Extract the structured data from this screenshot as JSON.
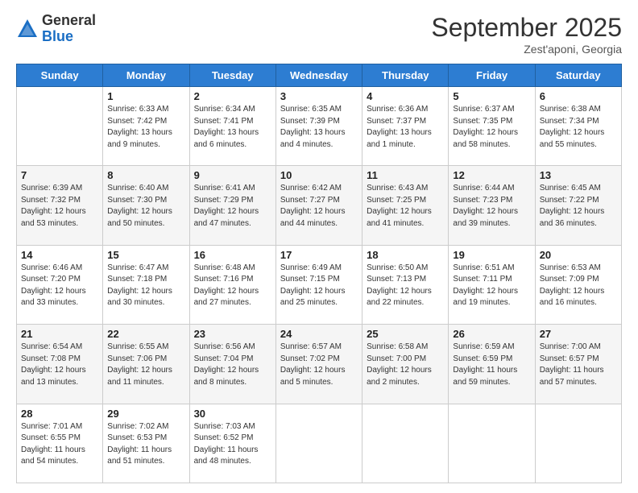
{
  "logo": {
    "general": "General",
    "blue": "Blue"
  },
  "header": {
    "month": "September 2025",
    "location": "Zest'aponi, Georgia"
  },
  "weekdays": [
    "Sunday",
    "Monday",
    "Tuesday",
    "Wednesday",
    "Thursday",
    "Friday",
    "Saturday"
  ],
  "weeks": [
    [
      {
        "day": "",
        "content": ""
      },
      {
        "day": "1",
        "content": "Sunrise: 6:33 AM\nSunset: 7:42 PM\nDaylight: 13 hours\nand 9 minutes."
      },
      {
        "day": "2",
        "content": "Sunrise: 6:34 AM\nSunset: 7:41 PM\nDaylight: 13 hours\nand 6 minutes."
      },
      {
        "day": "3",
        "content": "Sunrise: 6:35 AM\nSunset: 7:39 PM\nDaylight: 13 hours\nand 4 minutes."
      },
      {
        "day": "4",
        "content": "Sunrise: 6:36 AM\nSunset: 7:37 PM\nDaylight: 13 hours\nand 1 minute."
      },
      {
        "day": "5",
        "content": "Sunrise: 6:37 AM\nSunset: 7:35 PM\nDaylight: 12 hours\nand 58 minutes."
      },
      {
        "day": "6",
        "content": "Sunrise: 6:38 AM\nSunset: 7:34 PM\nDaylight: 12 hours\nand 55 minutes."
      }
    ],
    [
      {
        "day": "7",
        "content": "Sunrise: 6:39 AM\nSunset: 7:32 PM\nDaylight: 12 hours\nand 53 minutes."
      },
      {
        "day": "8",
        "content": "Sunrise: 6:40 AM\nSunset: 7:30 PM\nDaylight: 12 hours\nand 50 minutes."
      },
      {
        "day": "9",
        "content": "Sunrise: 6:41 AM\nSunset: 7:29 PM\nDaylight: 12 hours\nand 47 minutes."
      },
      {
        "day": "10",
        "content": "Sunrise: 6:42 AM\nSunset: 7:27 PM\nDaylight: 12 hours\nand 44 minutes."
      },
      {
        "day": "11",
        "content": "Sunrise: 6:43 AM\nSunset: 7:25 PM\nDaylight: 12 hours\nand 41 minutes."
      },
      {
        "day": "12",
        "content": "Sunrise: 6:44 AM\nSunset: 7:23 PM\nDaylight: 12 hours\nand 39 minutes."
      },
      {
        "day": "13",
        "content": "Sunrise: 6:45 AM\nSunset: 7:22 PM\nDaylight: 12 hours\nand 36 minutes."
      }
    ],
    [
      {
        "day": "14",
        "content": "Sunrise: 6:46 AM\nSunset: 7:20 PM\nDaylight: 12 hours\nand 33 minutes."
      },
      {
        "day": "15",
        "content": "Sunrise: 6:47 AM\nSunset: 7:18 PM\nDaylight: 12 hours\nand 30 minutes."
      },
      {
        "day": "16",
        "content": "Sunrise: 6:48 AM\nSunset: 7:16 PM\nDaylight: 12 hours\nand 27 minutes."
      },
      {
        "day": "17",
        "content": "Sunrise: 6:49 AM\nSunset: 7:15 PM\nDaylight: 12 hours\nand 25 minutes."
      },
      {
        "day": "18",
        "content": "Sunrise: 6:50 AM\nSunset: 7:13 PM\nDaylight: 12 hours\nand 22 minutes."
      },
      {
        "day": "19",
        "content": "Sunrise: 6:51 AM\nSunset: 7:11 PM\nDaylight: 12 hours\nand 19 minutes."
      },
      {
        "day": "20",
        "content": "Sunrise: 6:53 AM\nSunset: 7:09 PM\nDaylight: 12 hours\nand 16 minutes."
      }
    ],
    [
      {
        "day": "21",
        "content": "Sunrise: 6:54 AM\nSunset: 7:08 PM\nDaylight: 12 hours\nand 13 minutes."
      },
      {
        "day": "22",
        "content": "Sunrise: 6:55 AM\nSunset: 7:06 PM\nDaylight: 12 hours\nand 11 minutes."
      },
      {
        "day": "23",
        "content": "Sunrise: 6:56 AM\nSunset: 7:04 PM\nDaylight: 12 hours\nand 8 minutes."
      },
      {
        "day": "24",
        "content": "Sunrise: 6:57 AM\nSunset: 7:02 PM\nDaylight: 12 hours\nand 5 minutes."
      },
      {
        "day": "25",
        "content": "Sunrise: 6:58 AM\nSunset: 7:00 PM\nDaylight: 12 hours\nand 2 minutes."
      },
      {
        "day": "26",
        "content": "Sunrise: 6:59 AM\nSunset: 6:59 PM\nDaylight: 11 hours\nand 59 minutes."
      },
      {
        "day": "27",
        "content": "Sunrise: 7:00 AM\nSunset: 6:57 PM\nDaylight: 11 hours\nand 57 minutes."
      }
    ],
    [
      {
        "day": "28",
        "content": "Sunrise: 7:01 AM\nSunset: 6:55 PM\nDaylight: 11 hours\nand 54 minutes."
      },
      {
        "day": "29",
        "content": "Sunrise: 7:02 AM\nSunset: 6:53 PM\nDaylight: 11 hours\nand 51 minutes."
      },
      {
        "day": "30",
        "content": "Sunrise: 7:03 AM\nSunset: 6:52 PM\nDaylight: 11 hours\nand 48 minutes."
      },
      {
        "day": "",
        "content": ""
      },
      {
        "day": "",
        "content": ""
      },
      {
        "day": "",
        "content": ""
      },
      {
        "day": "",
        "content": ""
      }
    ]
  ]
}
